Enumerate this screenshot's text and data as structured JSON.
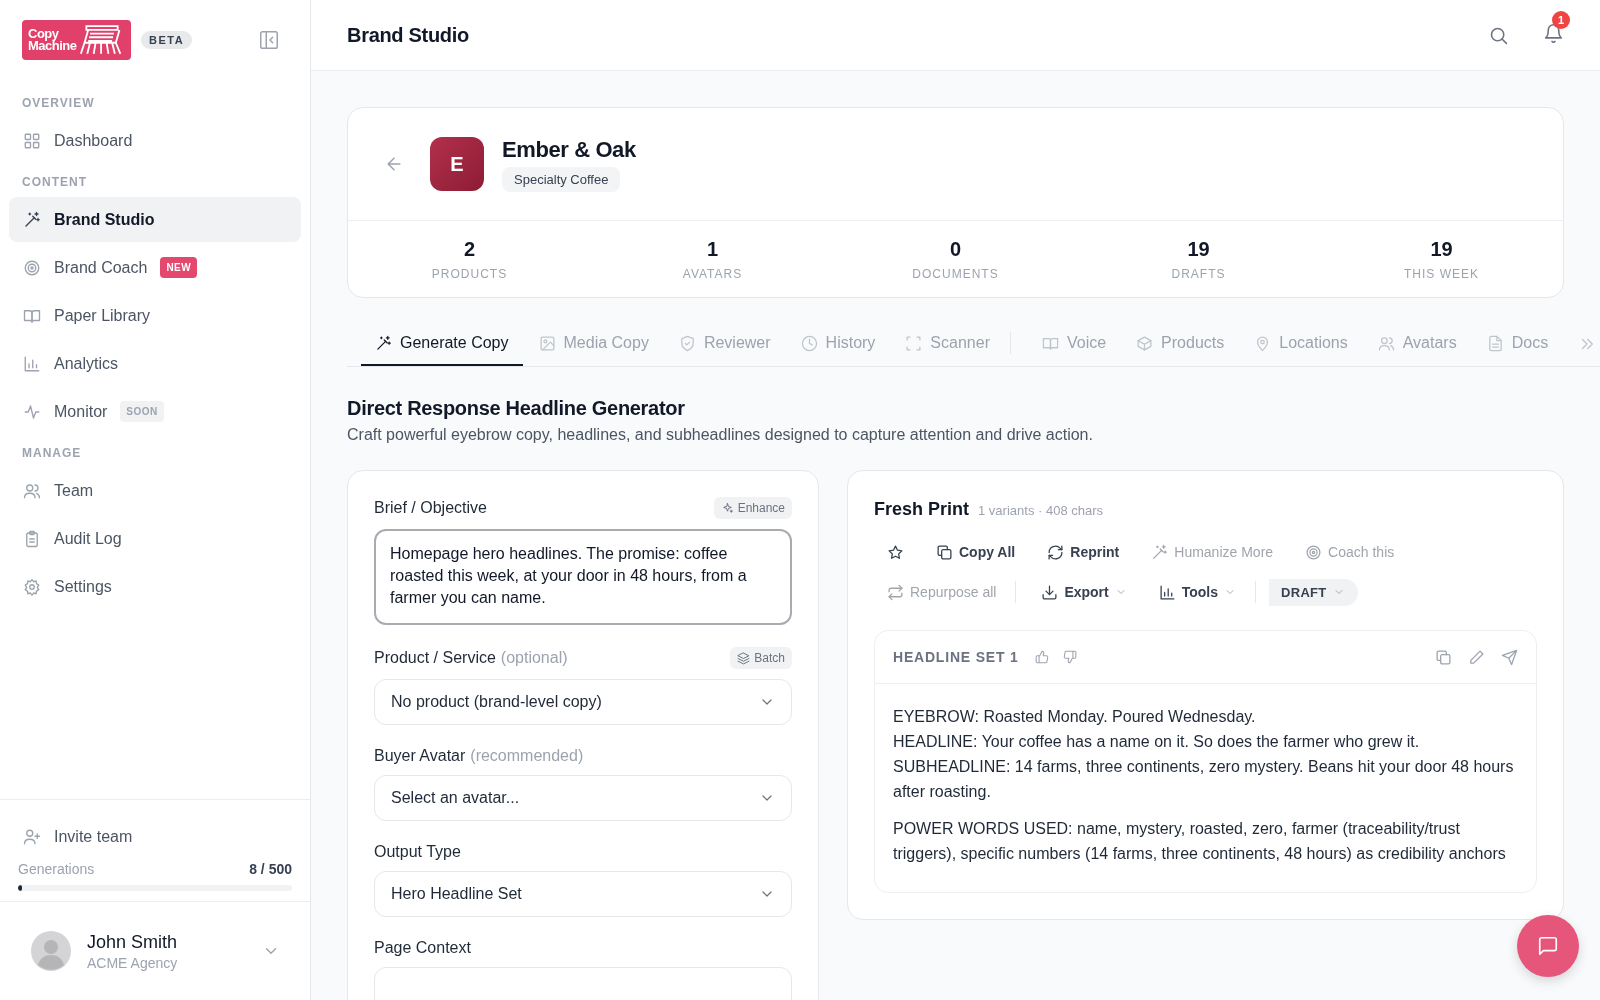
{
  "sidebar": {
    "logo": [
      "Copy",
      "Machine"
    ],
    "badge": "BETA",
    "sections": [
      {
        "title": "OVERVIEW",
        "items": [
          {
            "label": "Dashboard",
            "selected": false
          }
        ]
      },
      {
        "title": "CONTENT",
        "items": [
          {
            "label": "Brand Studio",
            "selected": true
          },
          {
            "label": "Brand Coach",
            "selected": false,
            "tag": {
              "text": "NEW",
              "color": "#e5486f"
            }
          },
          {
            "label": "Paper Library",
            "selected": false
          },
          {
            "label": "Analytics",
            "selected": false
          },
          {
            "label": "Monitor",
            "selected": false,
            "tag": {
              "text": "SOON",
              "color": "#f1f2f4"
            }
          }
        ]
      },
      {
        "title": "MANAGE",
        "items": [
          {
            "label": "Team",
            "selected": false
          },
          {
            "label": "Audit Log",
            "selected": false
          },
          {
            "label": "Settings",
            "selected": false
          }
        ]
      }
    ],
    "invite": "Invite team",
    "usage": {
      "label": "Generations",
      "value": "8 / 500",
      "level": 0.016
    },
    "user": {
      "name": "John Smith",
      "org": "ACME Agency"
    }
  },
  "header": {
    "title": "Brand Studio",
    "notifications": "1"
  },
  "brand": {
    "initial": "E",
    "name": "Ember & Oak",
    "category": "Specialty Coffee",
    "stats": [
      {
        "value": "2",
        "label": "PRODUCTS"
      },
      {
        "value": "1",
        "label": "AVATARS"
      },
      {
        "value": "0",
        "label": "DOCUMENTS"
      },
      {
        "value": "19",
        "label": "DRAFTS"
      },
      {
        "value": "19",
        "label": "THIS WEEK"
      }
    ]
  },
  "tabs": [
    {
      "label": "Generate Copy",
      "selected": true,
      "separator_before": false
    },
    {
      "label": "Media Copy",
      "selected": false,
      "separator_before": false
    },
    {
      "label": "Reviewer",
      "selected": false,
      "separator_before": false
    },
    {
      "label": "History",
      "selected": false,
      "separator_before": false
    },
    {
      "label": "Scanner",
      "selected": false,
      "separator_before": false
    },
    {
      "label": "Voice",
      "selected": false,
      "separator_before": true
    },
    {
      "label": "Products",
      "selected": false,
      "separator_before": false
    },
    {
      "label": "Locations",
      "selected": false,
      "separator_before": false
    },
    {
      "label": "Avatars",
      "selected": false,
      "separator_before": false
    },
    {
      "label": "Docs",
      "selected": false,
      "separator_before": false
    }
  ],
  "generator": {
    "title": "Direct Response Headline Generator",
    "subtitle": "Craft powerful eyebrow copy, headlines, and subheadlines designed to capture attention and drive action."
  },
  "form": {
    "fields": [
      {
        "kind": "textarea",
        "label": "Brief / Objective",
        "action": "Enhance",
        "value": "Homepage hero headlines. The promise: coffee roasted this week, at your door in 48 hours, from a farmer you can name."
      },
      {
        "kind": "select",
        "label": "Product / Service",
        "hint": "(optional)",
        "action": "Batch",
        "value": "No product (brand-level copy)"
      },
      {
        "kind": "select",
        "label": "Buyer Avatar",
        "hint": "(recommended)",
        "value": "Select an avatar..."
      },
      {
        "kind": "select",
        "label": "Output Type",
        "value": "Hero Headline Set"
      },
      {
        "kind": "partial",
        "label": "Page Context"
      }
    ]
  },
  "result": {
    "title": "Fresh Print",
    "meta": "1 variants · 408 chars",
    "toolbar": [
      [
        {
          "kind": "icon",
          "disabled": false,
          "dropdown": false,
          "separator_before": false
        },
        {
          "kind": "button",
          "label": "Copy All",
          "disabled": false,
          "dropdown": false,
          "separator_before": false
        },
        {
          "kind": "button",
          "label": "Reprint",
          "disabled": false,
          "dropdown": false,
          "separator_before": false
        },
        {
          "kind": "button",
          "label": "Humanize More",
          "disabled": true,
          "dropdown": false,
          "separator_before": false
        },
        {
          "kind": "button",
          "label": "Coach this",
          "disabled": true,
          "dropdown": false,
          "separator_before": false
        }
      ],
      [
        {
          "kind": "button",
          "label": "Repurpose all",
          "disabled": true,
          "dropdown": false,
          "separator_before": false
        },
        {
          "kind": "button",
          "label": "Export",
          "disabled": false,
          "dropdown": true,
          "separator_before": true
        },
        {
          "kind": "button",
          "label": "Tools",
          "disabled": false,
          "dropdown": true,
          "separator_before": false
        },
        {
          "kind": "pill",
          "label": "DRAFT",
          "disabled": false,
          "dropdown": true,
          "separator_before": true
        }
      ]
    ],
    "set": {
      "title": "HEADLINE SET 1",
      "paragraphs": [
        [
          "EYEBROW: Roasted Monday. Poured Wednesday.",
          "HEADLINE: Your coffee has a name on it. So does the farmer who grew it.",
          "SUBHEADLINE: 14 farms, three continents, zero mystery. Beans hit your door 48 hours after roasting."
        ],
        [
          "POWER WORDS USED: name, mystery, roasted, zero, farmer (traceability/trust triggers), specific numbers (14 farms, three continents, 48 hours) as credibility anchors"
        ]
      ]
    }
  }
}
